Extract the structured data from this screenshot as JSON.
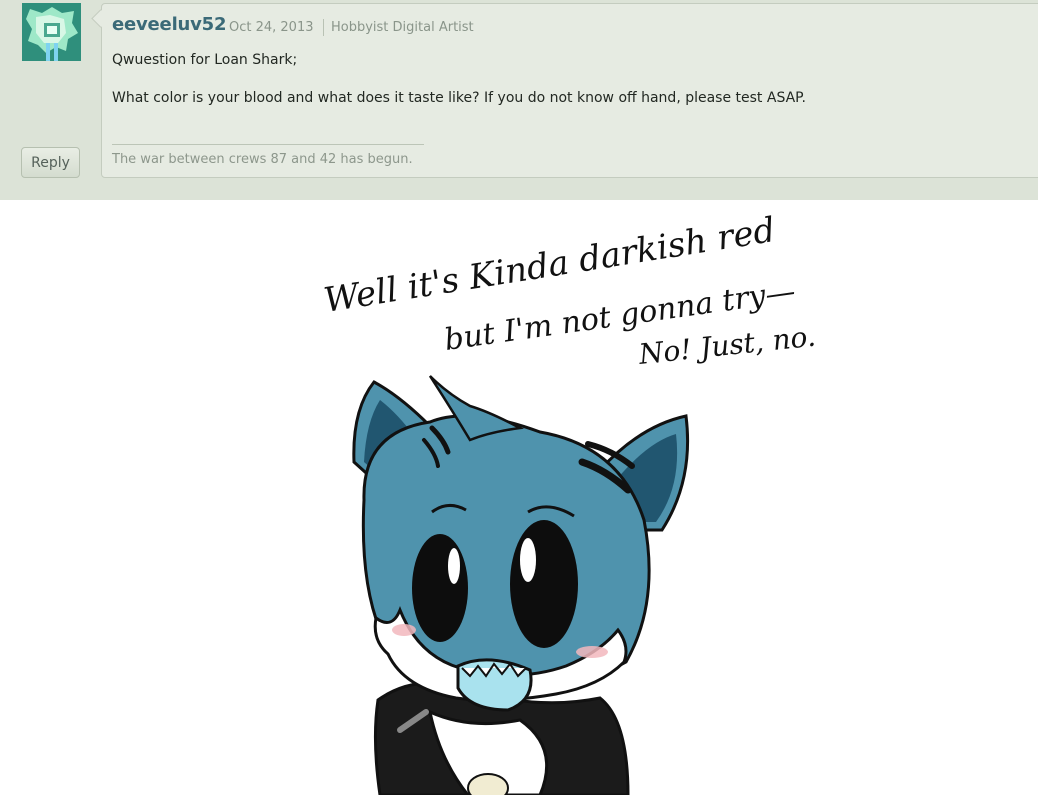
{
  "comment": {
    "username": "eeveeluv52",
    "date": "Oct 24, 2013",
    "user_title": "Hobbyist Digital Artist",
    "text_line1": "Qwuestion for Loan Shark;",
    "text_line2": "What color is your blood and what does it taste like? If you do not know off hand, please test ASAP.",
    "signature": "The war between crews 87 and 42 has begun.",
    "reply_label": "Reply"
  },
  "artwork": {
    "speech_line1": "Well it's Kinda darkish red",
    "speech_line2": "but I'm not gonna try—",
    "speech_line3": "No! Just, no.",
    "colors": {
      "fur": "#4f93ad",
      "fur_dark": "#215670",
      "outline": "#111111",
      "blush": "#f2b7bd",
      "mouth": "#a9e2ee",
      "panel_bg": "#dce3d7",
      "username": "#3b6a78"
    }
  }
}
